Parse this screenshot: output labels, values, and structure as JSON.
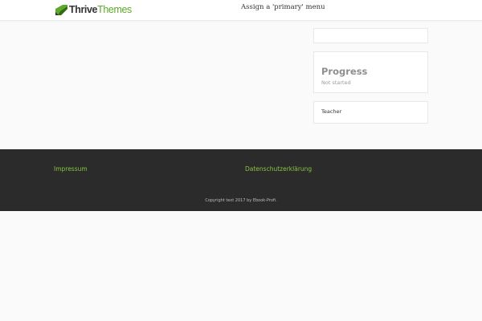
{
  "header": {
    "logo": {
      "word1": "Thrive",
      "word2": "Themes"
    },
    "menu_notice": "Assign a 'primary' menu"
  },
  "sidebar": {
    "progress": {
      "title": "Progress",
      "status": "Not started"
    },
    "teacher": {
      "label": "Teacher"
    }
  },
  "footer": {
    "links": [
      "Impressum",
      "Datenschutzerklärung"
    ],
    "copyright": "Copyright text 2017 by Ebook-Profi."
  },
  "colors": {
    "page_background": "#fafafa",
    "footer_background": "#2b2b2b",
    "accent_green": "#86c442",
    "logo_green": "#5ea82a"
  },
  "icons": {
    "logo_mark": "thrive-leaf-icon"
  }
}
